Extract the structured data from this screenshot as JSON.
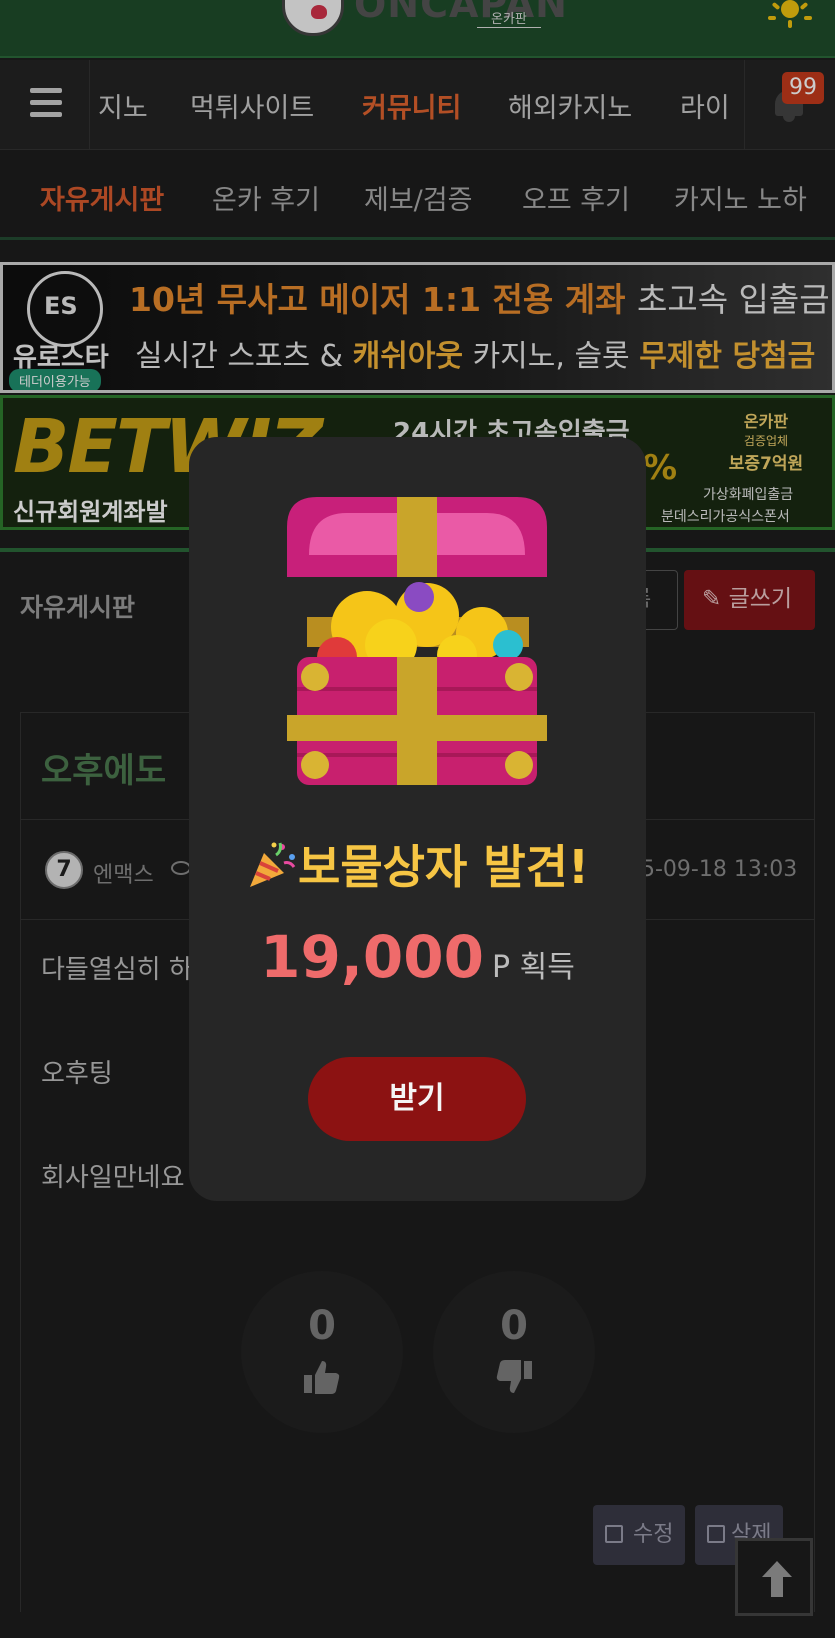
{
  "logo": {
    "text": "ONCAPAN",
    "sub": "온카판"
  },
  "nav": {
    "items": [
      "지노",
      "먹튀사이트",
      "커뮤니티",
      "해외카지노",
      "라이"
    ],
    "active_index": 2,
    "badge": "99"
  },
  "subnav": {
    "items": [
      "자유게시판",
      "온카 후기",
      "제보/검증",
      "오프 후기",
      "카지노 노하"
    ],
    "active_index": 0
  },
  "banner1": {
    "logo_text": "ES",
    "brand": "유로스타",
    "tether": "테더이용가능",
    "line1_a": "10년 무사고 메이저",
    "line1_b": "1:1 전용 계좌",
    "line1_c": "초고속 입출금",
    "line2_a": "실시간 스포츠 &",
    "line2_b": "캐쉬아웃",
    "line2_c": "카지노, 슬롯",
    "line2_d": "무제한 당첨금"
  },
  "banner2": {
    "brand": "BETWIZ",
    "new_member": "신규회원계좌발",
    "line1": "24시간 초고속입출금",
    "pct": "%",
    "award1": "온카판",
    "award2": "검증업체",
    "award3": "보증7억원",
    "crypto": "가상화폐입출금",
    "proof": "분데스리가공식스폰서"
  },
  "board": {
    "title": "자유게시판",
    "list_label": "록",
    "write_label": "글쓰기"
  },
  "post": {
    "title": "오후에도",
    "author_level": "7",
    "author": "엔맥스",
    "date": "5-09-18 13:03",
    "lines": [
      "다들열심히 하",
      "오후팅",
      "회사일만네요"
    ],
    "upvotes": "0",
    "downvotes": "0",
    "edit_label": "수정",
    "delete_label": "삭제"
  },
  "modal": {
    "title": "보물상자 발견!",
    "points": "19,000",
    "points_unit": "P 획득",
    "button": "받기"
  },
  "colors": {
    "accent_green": "#1f4d2b",
    "accent_orange": "#e0632f",
    "modal_title": "#f6c544",
    "points": "#ef6b6b",
    "receive_button": "#8c1212"
  }
}
